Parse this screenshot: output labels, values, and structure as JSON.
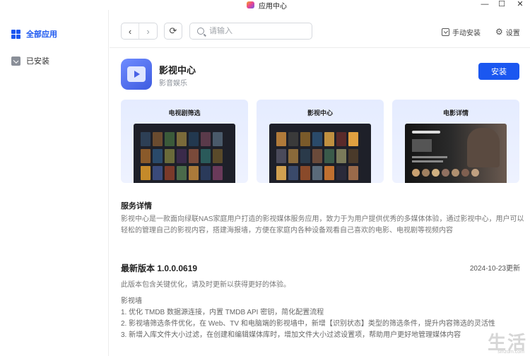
{
  "window": {
    "title": "应用中心",
    "controls": [
      "—",
      "☐",
      "✕"
    ]
  },
  "sidebar": {
    "items": [
      {
        "label": "全部应用",
        "icon": "grid-icon",
        "active": true
      },
      {
        "label": "已安装",
        "icon": "installed-icon",
        "active": false
      }
    ]
  },
  "toolbar": {
    "back": "‹",
    "forward": "›",
    "refresh": "⟳",
    "search_placeholder": "请输入",
    "manual_install": "手动安装",
    "settings": "设置",
    "gear": "⚙"
  },
  "app": {
    "name": "影视中心",
    "category": "影音娱乐",
    "install_label": "安装",
    "accent": "#1b57f0"
  },
  "screenshots": [
    {
      "caption": "电视剧筛选"
    },
    {
      "caption": "影视中心"
    },
    {
      "caption": "电影详情"
    }
  ],
  "service": {
    "title": "服务详情",
    "description": "影视中心是一款面向绿联NAS家庭用户打造的影视媒体服务应用，致力于为用户提供优秀的多媒体体验，通过影视中心，用户可以轻松的管理自己的影视内容，搭建海报墙，方便在家庭内各种设备观看自己喜欢的电影、电视剧等视频内容"
  },
  "version": {
    "title": "最新版本 1.0.0.0619",
    "date": "2024-10-23更新",
    "note": "此版本包含关键优化，请及时更新以获得更好的体验。",
    "changes": [
      "影视墙",
      "1. 优化 TMDB 数据源连接，内置 TMDB API 密钥，简化配置流程",
      "2. 影视墙筛选条件优化，在 Web、TV 和电脑端的影视墙中，新增【识别状态】类型的筛选条件，提升内容筛选的灵活性",
      "3. 新增入库文件大小过滤，在创建和编辑媒体库时，增加文件大小过滤设置项，帮助用户更好地管理媒体内容"
    ]
  },
  "watermark": {
    "main": "生活",
    "sub": "smzdm.com"
  }
}
